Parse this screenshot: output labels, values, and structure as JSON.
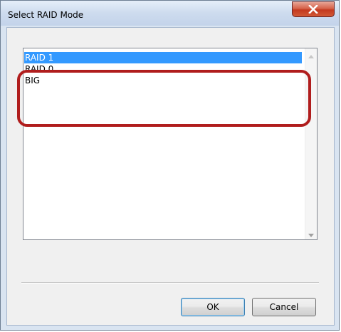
{
  "window": {
    "title": "Select RAID Mode"
  },
  "list": {
    "items": [
      {
        "label": "RAID 1",
        "selected": true
      },
      {
        "label": "RAID 0",
        "selected": false
      },
      {
        "label": "BIG",
        "selected": false
      }
    ]
  },
  "buttons": {
    "ok_label": "OK",
    "cancel_label": "Cancel"
  },
  "icons": {
    "close": "close-icon",
    "scroll_up": "scroll-up-arrow-icon",
    "scroll_down": "scroll-down-arrow-icon"
  },
  "colors": {
    "selection": "#3399ff",
    "highlight_outline": "#b01d1d",
    "close_button": "#c4391f"
  }
}
